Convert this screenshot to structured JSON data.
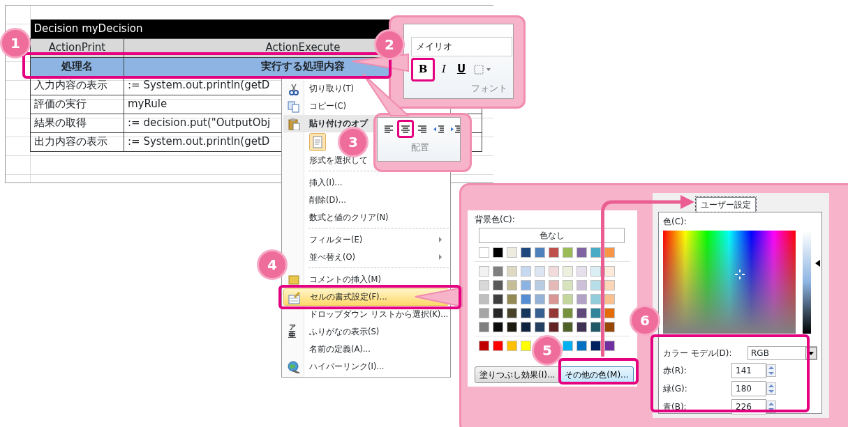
{
  "spreadsheet": {
    "title": "Decision myDecision",
    "column_headers": [
      "ActionPrint",
      "ActionExecute"
    ],
    "header_row": [
      "処理名",
      "実行する処理内容"
    ],
    "rows": [
      [
        "入力内容の表示",
        ":= System.out.println(getD"
      ],
      [
        "評価の実行",
        "myRule"
      ],
      [
        "結果の取得",
        ":= decision.put(\"OutputObj"
      ],
      [
        "出力内容の表示",
        ":= System.out.println(getD"
      ]
    ]
  },
  "context_menu": {
    "items": [
      {
        "kind": "item",
        "label": "切り取り(T)",
        "submenu": false,
        "highlighted": false
      },
      {
        "kind": "item",
        "label": "コピー(C)",
        "submenu": false,
        "highlighted": false
      },
      {
        "kind": "header",
        "label": "貼り付けのオプ",
        "submenu": false,
        "highlighted": false
      },
      {
        "kind": "paste_options"
      },
      {
        "kind": "item",
        "label": "形式を選択して",
        "submenu": false,
        "highlighted": false
      },
      {
        "kind": "separator"
      },
      {
        "kind": "item",
        "label": "挿入(I)...",
        "submenu": false,
        "highlighted": false
      },
      {
        "kind": "item",
        "label": "削除(D)...",
        "submenu": false,
        "highlighted": false
      },
      {
        "kind": "item",
        "label": "数式と値のクリア(N)",
        "submenu": false,
        "highlighted": false
      },
      {
        "kind": "separator"
      },
      {
        "kind": "item",
        "label": "フィルター(E)",
        "submenu": true,
        "highlighted": false
      },
      {
        "kind": "item",
        "label": "並べ替え(O)",
        "submenu": true,
        "highlighted": false
      },
      {
        "kind": "separator"
      },
      {
        "kind": "item",
        "label": "コメントの挿入(M)",
        "submenu": false,
        "highlighted": false
      },
      {
        "kind": "item",
        "label": "セルの書式設定(F)...",
        "submenu": false,
        "highlighted": true
      },
      {
        "kind": "item",
        "label": "ドロップダウン リストから選択(K)...",
        "submenu": false,
        "highlighted": false
      },
      {
        "kind": "item",
        "label": "ふりがなの表示(S)",
        "icon_text": [
          "ア",
          "亜"
        ],
        "submenu": false,
        "highlighted": false
      },
      {
        "kind": "item",
        "label": "名前の定義(A)...",
        "submenu": false,
        "highlighted": false
      },
      {
        "kind": "item",
        "label": "ハイパーリンク(I)...",
        "submenu": false,
        "highlighted": false
      }
    ]
  },
  "font_group": {
    "font_name": "メイリオ",
    "buttons": [
      {
        "kind": "bold",
        "label": "B",
        "selected": true
      },
      {
        "kind": "italic",
        "label": "I",
        "selected": false
      },
      {
        "kind": "underline",
        "label": "U",
        "selected": false
      },
      {
        "kind": "border",
        "selected": false
      }
    ],
    "group_label": "フォント"
  },
  "alignment_group": {
    "buttons": [
      {
        "kind": "align_left",
        "selected": false
      },
      {
        "kind": "align_center",
        "selected": true
      },
      {
        "kind": "align_right",
        "selected": false
      },
      {
        "kind": "indent_decrease",
        "selected": false
      },
      {
        "kind": "indent_increase",
        "selected": false
      }
    ],
    "group_label": "配置"
  },
  "fill_palette": {
    "label": "背景色(C):",
    "no_color": "色なし",
    "theme_colors": [
      {
        "color": "#ffffff"
      },
      {
        "color": "#000000"
      },
      {
        "color": "#eeece1"
      },
      {
        "color": "#1f497d"
      },
      {
        "color": "#4f81bd"
      },
      {
        "color": "#c0504d"
      },
      {
        "color": "#9bbb59"
      },
      {
        "color": "#8064a2"
      },
      {
        "color": "#4bacc6"
      },
      {
        "color": "#f79646"
      }
    ],
    "tints": [
      [
        {
          "color": "#f2f2f2"
        },
        {
          "color": "#7f7f7f"
        },
        {
          "color": "#ddd9c3"
        },
        {
          "color": "#c6d9f0"
        },
        {
          "color": "#dbe5f1"
        },
        {
          "color": "#f2dcdb"
        },
        {
          "color": "#ebf1dd"
        },
        {
          "color": "#e5e0ec"
        },
        {
          "color": "#dbeef3"
        },
        {
          "color": "#fdeada"
        }
      ],
      [
        {
          "color": "#d8d8d8"
        },
        {
          "color": "#595959"
        },
        {
          "color": "#c4bd97"
        },
        {
          "color": "#8db3e2"
        },
        {
          "color": "#b8cce4"
        },
        {
          "color": "#e5b9b7"
        },
        {
          "color": "#d7e3bc"
        },
        {
          "color": "#ccc1d9"
        },
        {
          "color": "#b7dde8"
        },
        {
          "color": "#fbd5b5"
        }
      ],
      [
        {
          "color": "#bfbfbf"
        },
        {
          "color": "#3f3f3f"
        },
        {
          "color": "#938953"
        },
        {
          "color": "#548dd4"
        },
        {
          "color": "#95b3d7"
        },
        {
          "color": "#d99694"
        },
        {
          "color": "#c3d69b"
        },
        {
          "color": "#b2a2c7"
        },
        {
          "color": "#92cddc"
        },
        {
          "color": "#fac08f"
        }
      ],
      [
        {
          "color": "#a5a5a5"
        },
        {
          "color": "#262626"
        },
        {
          "color": "#494429"
        },
        {
          "color": "#17365d"
        },
        {
          "color": "#366092"
        },
        {
          "color": "#953734"
        },
        {
          "color": "#76923c"
        },
        {
          "color": "#5f497a"
        },
        {
          "color": "#31859b"
        },
        {
          "color": "#e36c09"
        }
      ],
      [
        {
          "color": "#7f7f7f"
        },
        {
          "color": "#0c0c0c"
        },
        {
          "color": "#1d1b10"
        },
        {
          "color": "#0f243e"
        },
        {
          "color": "#244061"
        },
        {
          "color": "#632423"
        },
        {
          "color": "#4f6128"
        },
        {
          "color": "#3f3151"
        },
        {
          "color": "#205867"
        },
        {
          "color": "#974806"
        }
      ]
    ],
    "standard_colors": [
      {
        "color": "#c00000"
      },
      {
        "color": "#ff0000"
      },
      {
        "color": "#ffc000"
      },
      {
        "color": "#ffff00"
      },
      {
        "color": "#00b0f0"
      },
      {
        "color": "#0070c0"
      },
      {
        "color": "#002060"
      },
      {
        "color": "#7030a0"
      }
    ],
    "fill_effects_button": "塗りつぶし効果(I)...",
    "more_colors_button": "その他の色(M)..."
  },
  "color_dialog": {
    "tabs": [
      {
        "label": "ユーザー設定",
        "selected": true
      }
    ],
    "color_label": "色(C):",
    "luminance": {
      "level": 0.68
    },
    "model_label": "カラー モデル(D):",
    "model": "RGB",
    "channels": [
      {
        "label": "赤(R):",
        "value": "141"
      },
      {
        "label": "緑(G):",
        "value": "180"
      },
      {
        "label": "青(B):",
        "value": "226"
      }
    ]
  },
  "callouts": [
    {
      "number": "1"
    },
    {
      "number": "2"
    },
    {
      "number": "3"
    },
    {
      "number": "4"
    },
    {
      "number": "5"
    },
    {
      "number": "6"
    }
  ]
}
